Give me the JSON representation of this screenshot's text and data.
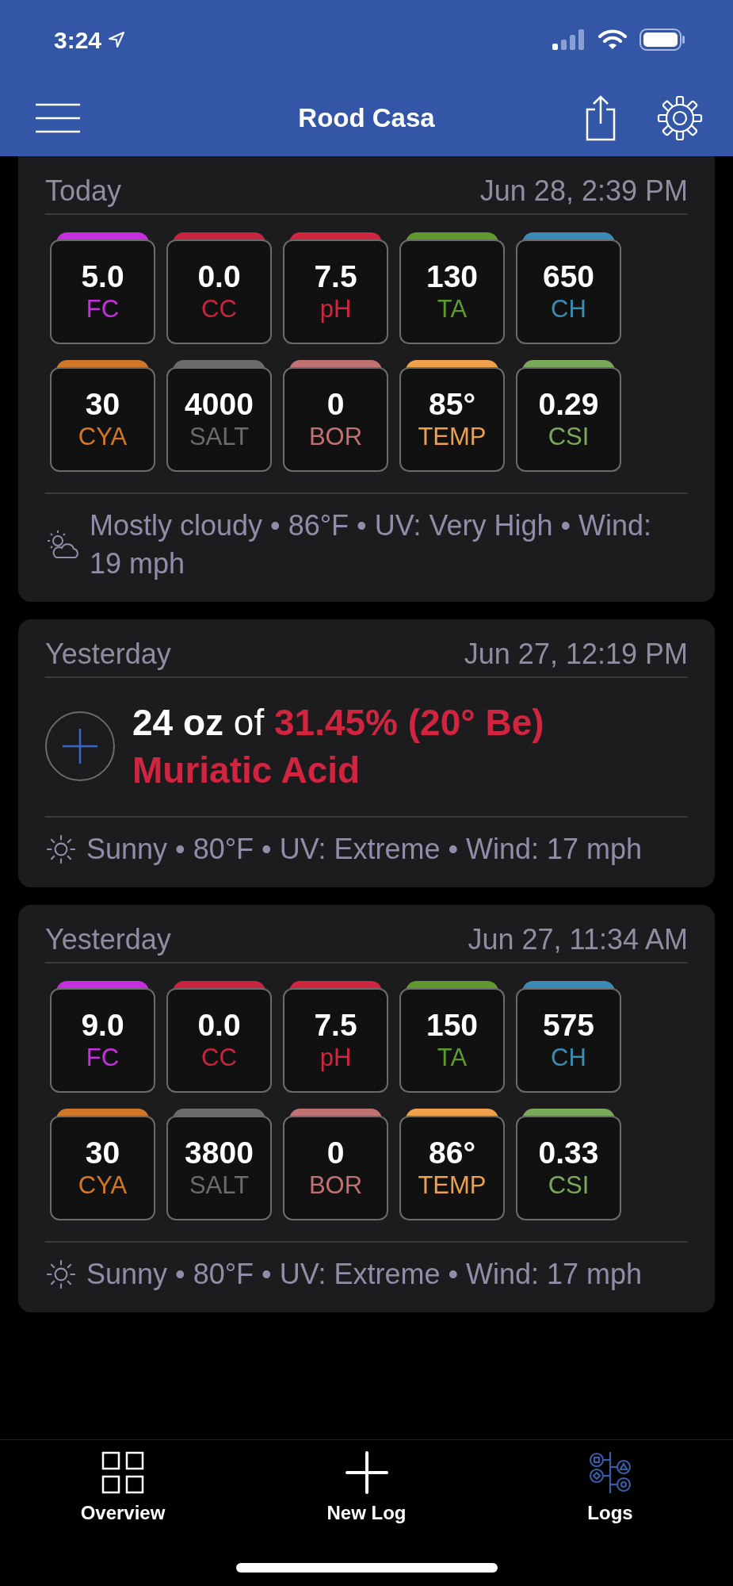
{
  "status_bar": {
    "time": "3:24"
  },
  "header": {
    "title": "Rood Casa"
  },
  "logs": [
    {
      "kind": "reading",
      "day": "Today",
      "timestamp": "Jun 28, 2:39 PM",
      "readings": [
        {
          "value": "5.0",
          "label": "FC",
          "color": "#c52fe0"
        },
        {
          "value": "0.0",
          "label": "CC",
          "color": "#c8243f"
        },
        {
          "value": "7.5",
          "label": "pH",
          "color": "#d0263f"
        },
        {
          "value": "130",
          "label": "TA",
          "color": "#5f9a2e"
        },
        {
          "value": "650",
          "label": "CH",
          "color": "#3b8cb5"
        },
        {
          "value": "30",
          "label": "CYA",
          "color": "#d2772a"
        },
        {
          "value": "4000",
          "label": "SALT",
          "color": "#6b6b6b"
        },
        {
          "value": "0",
          "label": "BOR",
          "color": "#c07272"
        },
        {
          "value": "85°",
          "label": "TEMP",
          "color": "#f0a04b"
        },
        {
          "value": "0.29",
          "label": "CSI",
          "color": "#7aa95a"
        }
      ],
      "weather": {
        "kind": "partly_cloudy",
        "text": "Mostly cloudy • 86°F • UV: Very High • Wind: 19 mph"
      }
    },
    {
      "kind": "dose",
      "day": "Yesterday",
      "timestamp": "Jun 27, 12:19 PM",
      "amount": "24 oz",
      "connector": "of",
      "product": "31.45% (20° Be) Muriatic Acid",
      "weather": {
        "kind": "sunny",
        "text": "Sunny • 80°F • UV: Extreme • Wind: 17 mph"
      }
    },
    {
      "kind": "reading",
      "day": "Yesterday",
      "timestamp": "Jun 27, 11:34 AM",
      "readings": [
        {
          "value": "9.0",
          "label": "FC",
          "color": "#c52fe0"
        },
        {
          "value": "0.0",
          "label": "CC",
          "color": "#c8243f"
        },
        {
          "value": "7.5",
          "label": "pH",
          "color": "#d0263f"
        },
        {
          "value": "150",
          "label": "TA",
          "color": "#5f9a2e"
        },
        {
          "value": "575",
          "label": "CH",
          "color": "#3b8cb5"
        },
        {
          "value": "30",
          "label": "CYA",
          "color": "#d2772a"
        },
        {
          "value": "3800",
          "label": "SALT",
          "color": "#6b6b6b"
        },
        {
          "value": "0",
          "label": "BOR",
          "color": "#c07272"
        },
        {
          "value": "86°",
          "label": "TEMP",
          "color": "#f0a04b"
        },
        {
          "value": "0.33",
          "label": "CSI",
          "color": "#7aa95a"
        }
      ],
      "weather": {
        "kind": "sunny",
        "text": "Sunny • 80°F • UV: Extreme • Wind: 17 mph"
      }
    }
  ],
  "tab_bar": [
    {
      "kind": "overview",
      "label": "Overview",
      "selected": false
    },
    {
      "kind": "new",
      "label": "New Log",
      "selected": false
    },
    {
      "kind": "logs",
      "label": "Logs",
      "selected": true
    }
  ]
}
